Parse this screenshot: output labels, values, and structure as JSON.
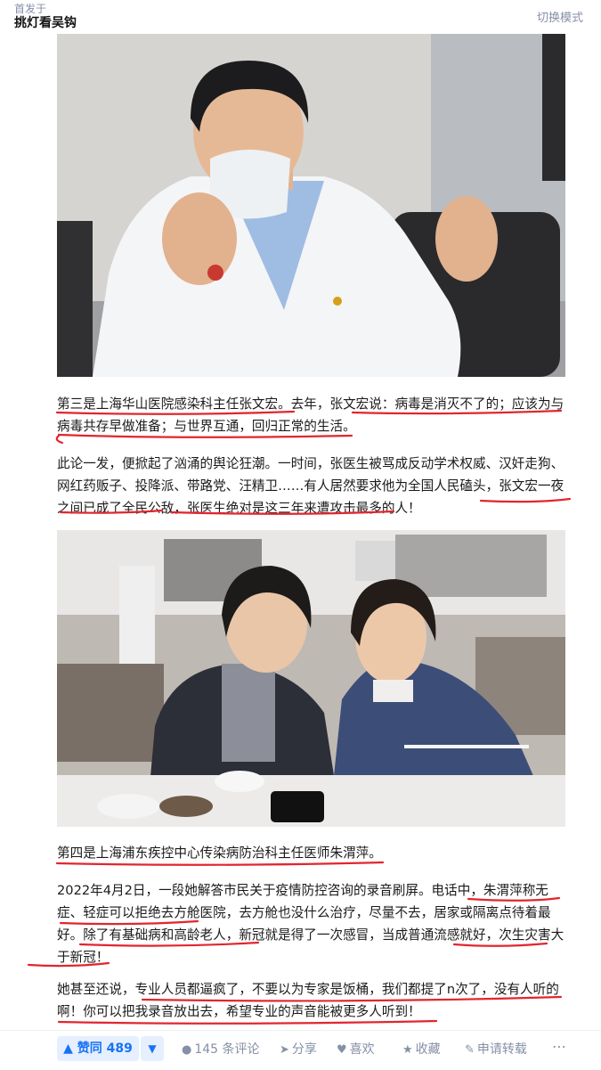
{
  "header": {
    "first_published_label": "首发于",
    "column_name": "挑灯看吴钩",
    "switch_mode": "切换模式"
  },
  "photos": [
    {
      "name": "doctor-in-white-coat-photo"
    },
    {
      "name": "two-women-at-dinner-table-photo"
    }
  ],
  "article": {
    "p1": "第三是上海华山医院感染科主任张文宏。去年，张文宏说：病毒是消灭不了的；应该为与病毒共存早做准备；与世界互通，回归正常的生活。",
    "p2": "此论一发，便掀起了汹涌的舆论狂潮。一时间，张医生被骂成反动学术权威、汉奸走狗、网红药贩子、投降派、带路党、汪精卫……有人居然要求他为全国人民磕头，张文宏一夜之间已成了全民公敌，张医生绝对是这三年来遭攻击最多的人！",
    "p3": "第四是上海浦东疾控中心传染病防治科主任医师朱渭萍。",
    "p4": "2022年4月2日，一段她解答市民关于疫情防控咨询的录音刷屏。电话中，朱渭萍称无症、轻症可以拒绝去方舱医院，去方舱也没什么治疗，尽量不去，居家或隔离点待着最好。除了有基础病和高龄老人，新冠就是得了一次感冒，当成普通流感就好，次生灾害大于新冠！",
    "p5": "她甚至还说，专业人员都逼疯了，不要以为专家是饭桶，我们都提了n次了，没有人听的啊！你可以把我录音放出去，希望专业的声音能被更多人听到！"
  },
  "actions": {
    "vote_up": "▲ 赞同 489",
    "vote_down": "▼",
    "comment": "145 条评论",
    "share": "分享",
    "like": "喜欢",
    "favorite": "收藏",
    "repost": "申请转载",
    "more": "⋯",
    "icons": {
      "comment": "comment-bubble-icon",
      "share": "share-arrow-icon",
      "like": "heart-icon",
      "favorite": "star-icon",
      "repost": "pen-icon"
    }
  },
  "colors": {
    "accent_blue": "#1772f6",
    "vote_bg": "#e5effd",
    "muted_gray": "#8590a6",
    "annotation_red": "#e1262e"
  }
}
